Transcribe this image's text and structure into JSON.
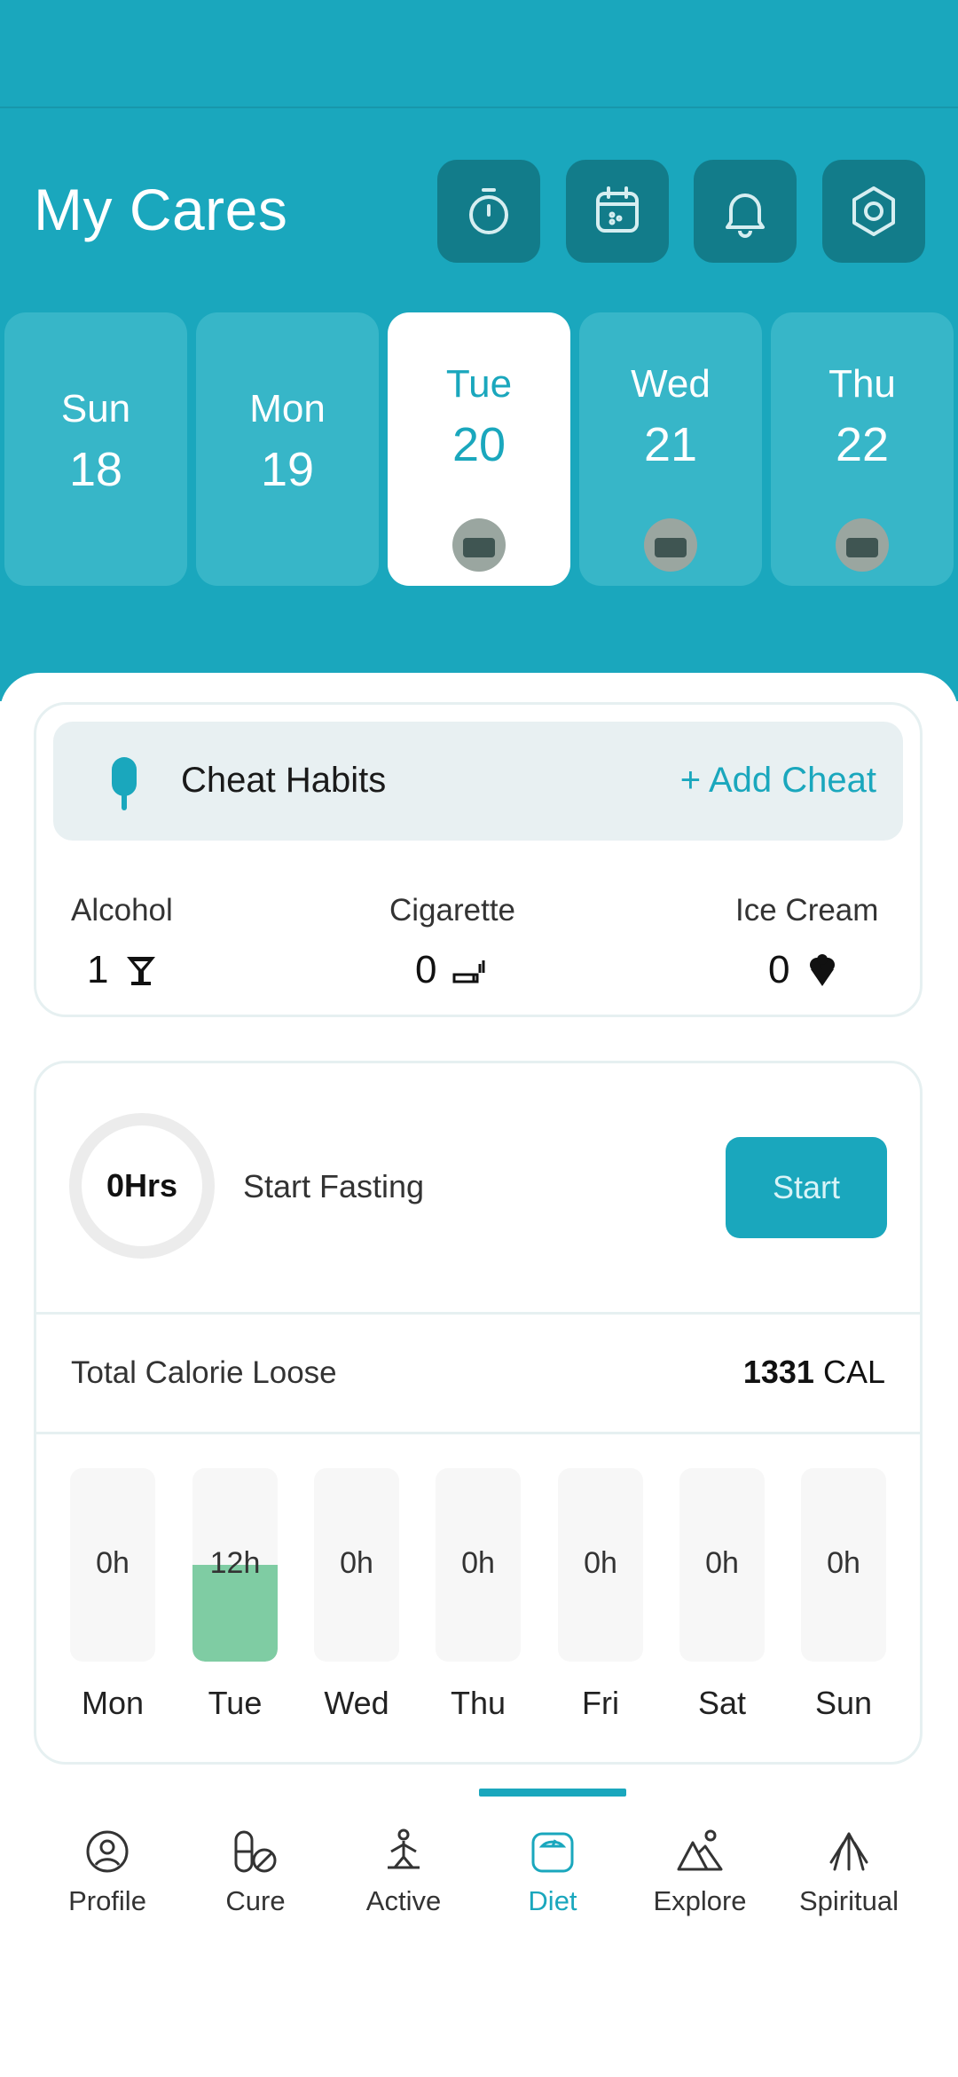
{
  "header": {
    "title": "My Cares",
    "actions": [
      "timer-icon",
      "calendar-icon",
      "bell-icon",
      "settings-icon"
    ]
  },
  "days": [
    {
      "name": "Sun",
      "num": "18",
      "selected": false,
      "has_avatar": false
    },
    {
      "name": "Mon",
      "num": "19",
      "selected": false,
      "has_avatar": false
    },
    {
      "name": "Tue",
      "num": "20",
      "selected": true,
      "has_avatar": true
    },
    {
      "name": "Wed",
      "num": "21",
      "selected": false,
      "has_avatar": true
    },
    {
      "name": "Thu",
      "num": "22",
      "selected": false,
      "has_avatar": true
    }
  ],
  "cheat": {
    "title": "Cheat Habits",
    "add_label": "+ Add Cheat",
    "habits": [
      {
        "label": "Alcohol",
        "count": "1",
        "icon": "cocktail-icon"
      },
      {
        "label": "Cigarette",
        "count": "0",
        "icon": "cigarette-icon"
      },
      {
        "label": "Ice Cream",
        "count": "0",
        "icon": "ice-cream-icon"
      }
    ]
  },
  "fasting": {
    "hours": "0Hrs",
    "label": "Start Fasting",
    "button": "Start"
  },
  "calories": {
    "label": "Total Calorie Loose",
    "value": "1331",
    "unit": "CAL"
  },
  "week": [
    {
      "day": "Mon",
      "label": "0h",
      "hours": 0
    },
    {
      "day": "Tue",
      "label": "12h",
      "hours": 12
    },
    {
      "day": "Wed",
      "label": "0h",
      "hours": 0
    },
    {
      "day": "Thu",
      "label": "0h",
      "hours": 0
    },
    {
      "day": "Fri",
      "label": "0h",
      "hours": 0
    },
    {
      "day": "Sat",
      "label": "0h",
      "hours": 0
    },
    {
      "day": "Sun",
      "label": "0h",
      "hours": 0
    }
  ],
  "colors": {
    "accent": "#1aa7bd",
    "fasting_fill": "#7fcca3"
  },
  "nav": [
    {
      "label": "Profile",
      "icon": "profile-icon",
      "active": false
    },
    {
      "label": "Cure",
      "icon": "cure-icon",
      "active": false
    },
    {
      "label": "Active",
      "icon": "yoga-icon",
      "active": false
    },
    {
      "label": "Diet",
      "icon": "scale-icon",
      "active": true
    },
    {
      "label": "Explore",
      "icon": "mountain-icon",
      "active": false
    },
    {
      "label": "Spiritual",
      "icon": "prayer-hands-icon",
      "active": false
    }
  ]
}
